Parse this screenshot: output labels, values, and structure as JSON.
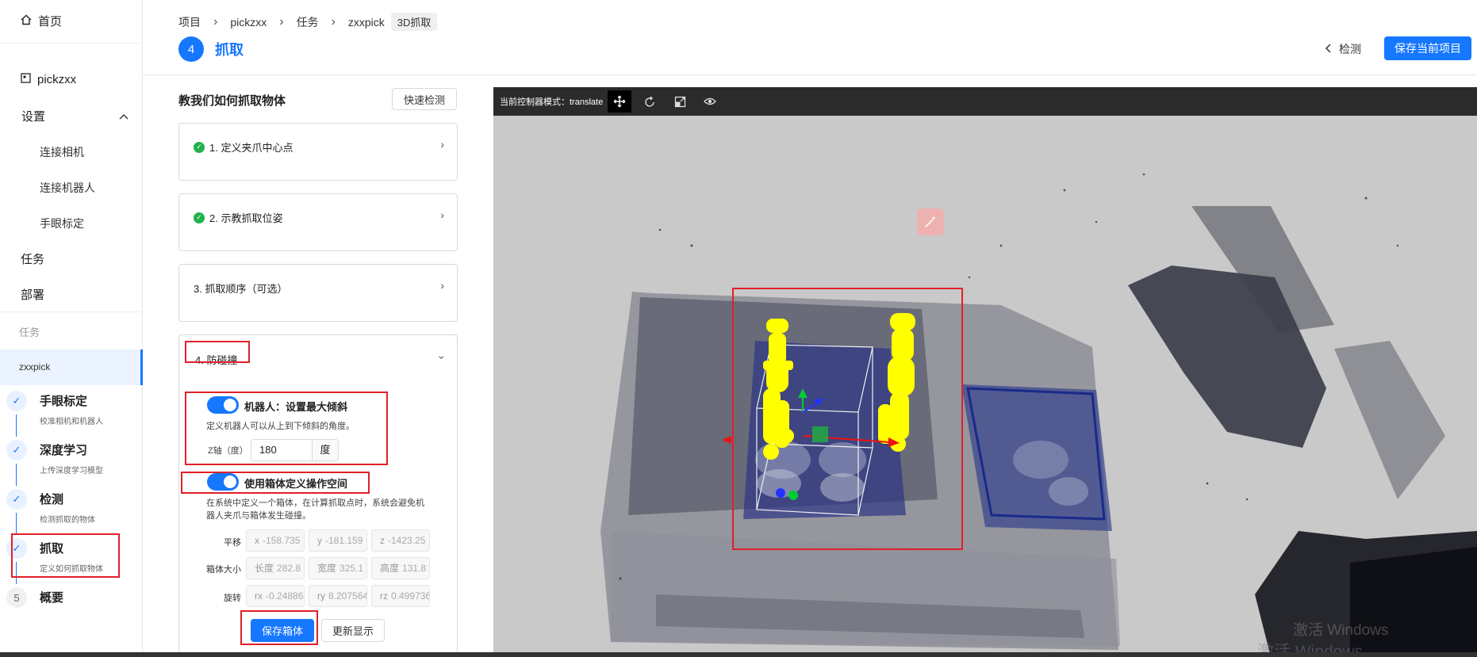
{
  "sidebar": {
    "home": "首页",
    "project": "pickzxx",
    "settings": "设置",
    "settings_items": [
      "连接相机",
      "连接机器人",
      "手眼标定"
    ],
    "tasks": "任务",
    "deploy": "部署",
    "group_task": "任务",
    "active_task": "zxxpick",
    "steps": [
      {
        "mark": "✓",
        "title": "手眼标定",
        "desc": "校准相机和机器人"
      },
      {
        "mark": "✓",
        "title": "深度学习",
        "desc": "上传深度学习模型"
      },
      {
        "mark": "✓",
        "title": "检测",
        "desc": "检测抓取的物体"
      },
      {
        "mark": "✓",
        "title": "抓取",
        "desc": "定义如何抓取物体"
      },
      {
        "mark": "5",
        "title": "概要",
        "desc": ""
      }
    ]
  },
  "header": {
    "breadcrumb": [
      "项目",
      "pickzxx",
      "任务",
      "zxxpick"
    ],
    "breadcrumb_tag": "3D抓取",
    "step_number": "4",
    "step_title": "抓取",
    "back_label": "检测",
    "save_project_label": "保存当前项目"
  },
  "panel": {
    "title": "教我们如何抓取物体",
    "quick_check_label": "快速检测",
    "cards": [
      {
        "title": "1. 定义夹爪中心点",
        "done": true
      },
      {
        "title": "2. 示教抓取位姿",
        "done": true
      },
      {
        "title": "3. 抓取顺序（可选）",
        "done": false
      },
      {
        "title": "4. 防碰撞",
        "done": false
      }
    ],
    "robot_toggle_label": "机器人：设置最大倾斜",
    "robot_toggle_desc": "定义机器人可以从上到下倾斜的角度。",
    "z_label": "Z轴（度）",
    "z_value": "180",
    "z_unit": "度",
    "box_toggle_label": "使用箱体定义操作空间",
    "box_toggle_desc_1": "在系统中定义一个箱体，在计算抓取点时，系统会避免机",
    "box_toggle_desc_2": "器人夹爪与箱体发生碰撞。",
    "translation_label": "平移",
    "size_label": "箱体大小",
    "rotation_label": "旋转",
    "translation": [
      {
        "prefix": "x",
        "value": "-158.735"
      },
      {
        "prefix": "y",
        "value": "-181.159"
      },
      {
        "prefix": "z",
        "value": "-1423.25"
      }
    ],
    "size": [
      {
        "prefix": "长度",
        "value": "282.8"
      },
      {
        "prefix": "宽度",
        "value": "325.1"
      },
      {
        "prefix": "高度",
        "value": "131.8"
      }
    ],
    "rotation": [
      {
        "prefix": "rx",
        "value": "-0.24886"
      },
      {
        "prefix": "ry",
        "value": "8.207564"
      },
      {
        "prefix": "rz",
        "value": "0.499736"
      }
    ],
    "save_box_label": "保存箱体",
    "refresh_label": "更新显示"
  },
  "viewer": {
    "mode_label": "当前控制器模式：",
    "mode_value": "translate",
    "tools": [
      "move-icon",
      "rotate-icon",
      "scale-icon",
      "eye-icon"
    ]
  },
  "watermark": "激活 Windows",
  "colors": {
    "accent": "#1677ff",
    "success": "#22b14c",
    "highlight": "#e0202a",
    "gripper": "#ffff00",
    "box_wire": "#1a2a8a"
  }
}
